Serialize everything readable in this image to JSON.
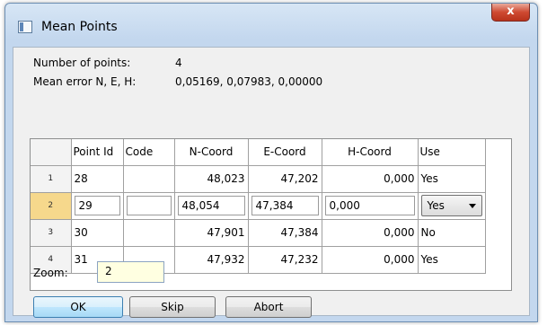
{
  "window": {
    "title": "Mean Points",
    "close_glyph": "x"
  },
  "info": {
    "points_label": "Number of points:",
    "points_value": "4",
    "error_label": "Mean error N, E, H:",
    "error_value": "0,05169, 0,07983, 0,00000"
  },
  "table": {
    "columns": [
      "Point Id",
      "Code",
      "N-Coord",
      "E-Coord",
      "H-Coord",
      "Use"
    ],
    "rows": [
      {
        "num": "1",
        "point_id": "28",
        "code": "",
        "n": "48,023",
        "e": "47,202",
        "h": "0,000",
        "use": "Yes"
      },
      {
        "num": "2",
        "point_id": "29",
        "code": "",
        "n": "48,054",
        "e": "47,384",
        "h": "0,000",
        "use": "Yes"
      },
      {
        "num": "3",
        "point_id": "30",
        "code": "",
        "n": "47,901",
        "e": "47,384",
        "h": "0,000",
        "use": "No"
      },
      {
        "num": "4",
        "point_id": "31",
        "code": "",
        "n": "47,932",
        "e": "47,232",
        "h": "0,000",
        "use": "Yes"
      }
    ]
  },
  "zoom": {
    "label": "Zoom:",
    "value": "2"
  },
  "buttons": {
    "ok": "OK",
    "skip": "Skip",
    "abort": "Abort"
  }
}
